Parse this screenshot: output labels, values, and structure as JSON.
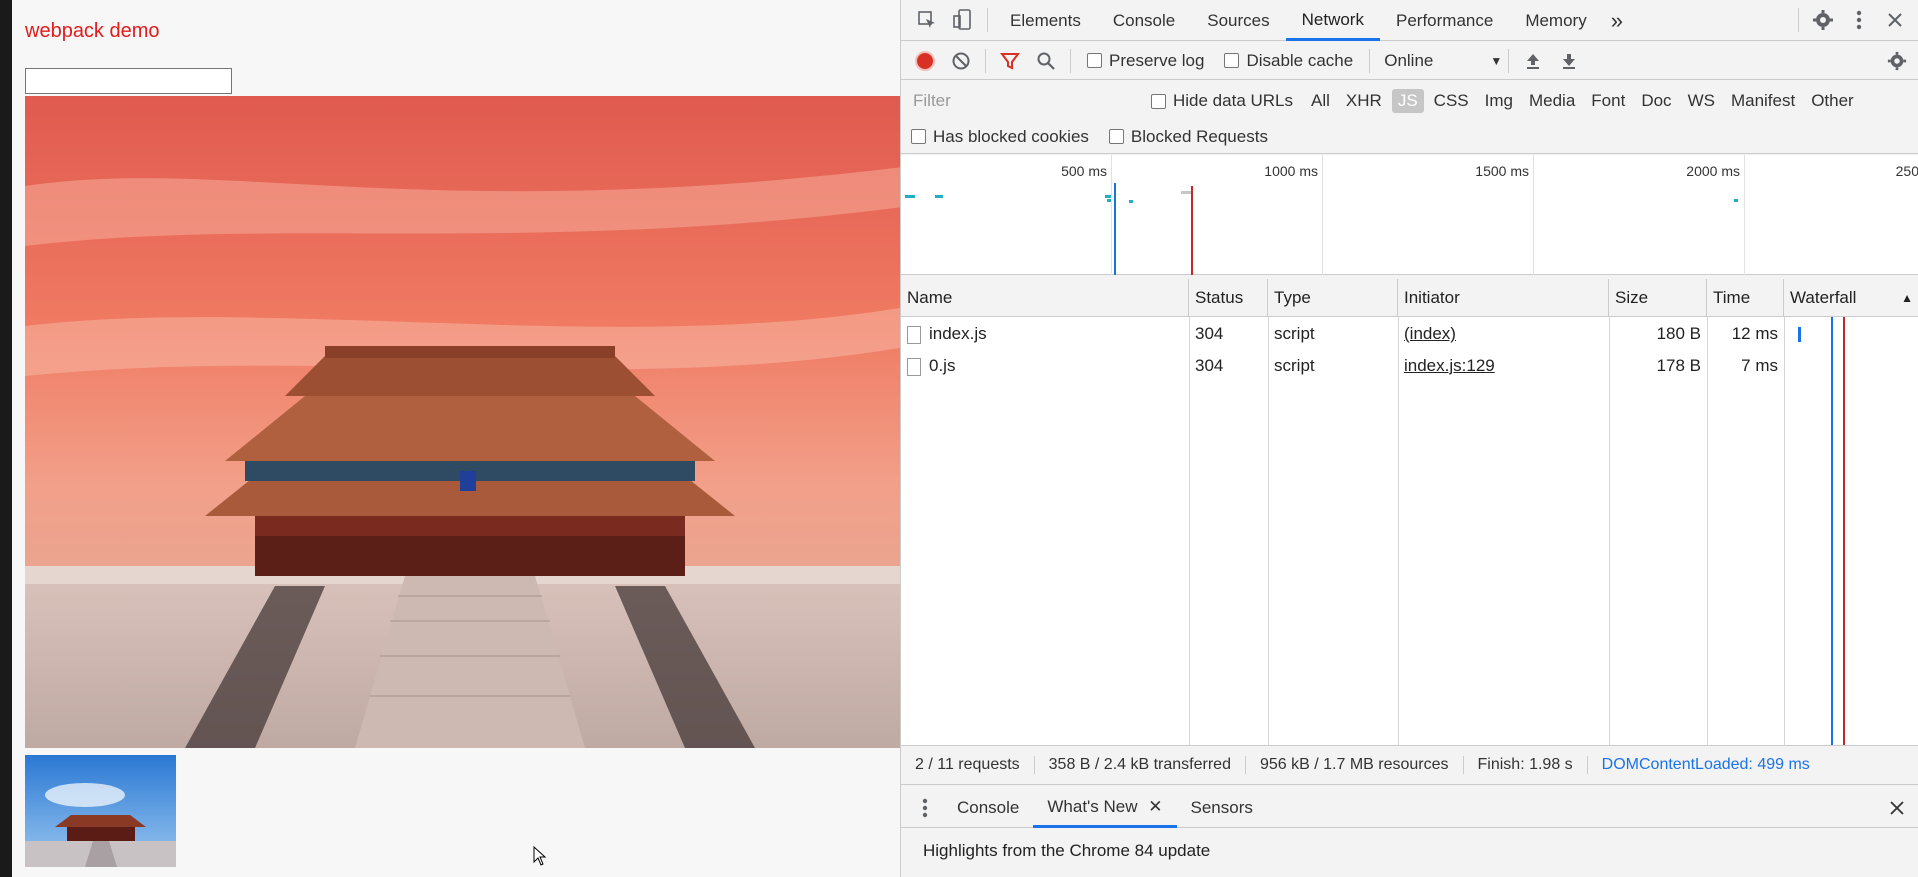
{
  "page": {
    "title": "webpack demo",
    "input_value": ""
  },
  "devtools": {
    "tabs": [
      "Elements",
      "Console",
      "Sources",
      "Network",
      "Performance",
      "Memory"
    ],
    "active_tab": "Network",
    "more_tabs": "»",
    "toolbar": {
      "preserve_log": "Preserve log",
      "disable_cache": "Disable cache",
      "throttle": "Online"
    },
    "filter": {
      "placeholder": "Filter",
      "hide_data_urls": "Hide data URLs",
      "types": [
        "All",
        "XHR",
        "JS",
        "CSS",
        "Img",
        "Media",
        "Font",
        "Doc",
        "WS",
        "Manifest",
        "Other"
      ],
      "active_type": "JS",
      "has_blocked_cookies": "Has blocked cookies",
      "blocked_requests": "Blocked Requests"
    },
    "overview": {
      "ticks": [
        "500 ms",
        "1000 ms",
        "1500 ms",
        "2000 ms",
        "250"
      ]
    },
    "columns": {
      "name": "Name",
      "status": "Status",
      "type": "Type",
      "initiator": "Initiator",
      "size": "Size",
      "time": "Time",
      "waterfall": "Waterfall"
    },
    "requests": [
      {
        "name": "index.js",
        "status": "304",
        "type": "script",
        "initiator": "(index)",
        "size": "180 B",
        "time": "12 ms"
      },
      {
        "name": "0.js",
        "status": "304",
        "type": "script",
        "initiator": "index.js:129",
        "size": "178 B",
        "time": "7 ms"
      }
    ],
    "summary": {
      "requests": "2 / 11 requests",
      "transferred": "358 B / 2.4 kB transferred",
      "resources": "956 kB / 1.7 MB resources",
      "finish": "Finish: 1.98 s",
      "dcl": "DOMContentLoaded: 499 ms"
    },
    "drawer": {
      "tabs": [
        "Console",
        "What's New",
        "Sensors"
      ],
      "active_tab": "What's New",
      "message": "Highlights from the Chrome 84 update"
    },
    "colors": {
      "accent": "#1a73e8",
      "record": "#d93025",
      "load_line": "#c62828"
    }
  }
}
